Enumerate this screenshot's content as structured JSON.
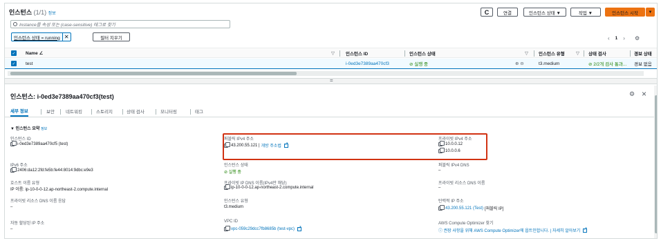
{
  "header": {
    "title": "인스턴스",
    "count": "(1/1)",
    "info": "정보",
    "search_placeholder": "Instance를 속성 또는 (case-sensitive) 태그로 찾기",
    "connect_label": "연결",
    "state_label": "인스턴스 상태 ▼",
    "actions_label": "작업 ▼",
    "launch_label": "인스턴스 시작",
    "refresh_icon": "C",
    "dropdown_icon": "▼"
  },
  "filter": {
    "token": "인스턴스 상태 = running",
    "remove": "✕",
    "clear_label": "필터 지우기"
  },
  "pagination": {
    "prev": "‹",
    "page": "1",
    "next": "›",
    "settings_icon": "⚙"
  },
  "table": {
    "columns": {
      "name": "Name ∠",
      "instance_id": "인스턴스 ID",
      "instance_state": "인스턴스 상태",
      "instance_type": "인스턴스 유형",
      "status_check": "상태 검사",
      "alarm_status": "경보 상태"
    },
    "row": {
      "name": "test",
      "instance_id": "i-0ed3e7389aa470cf3",
      "instance_state": "⊘ 실행 중",
      "zoom_icons": "⊕ ⊖",
      "instance_type": "t3.medium",
      "status_check": "⊘ 2/2개 검사 통과...",
      "alarm_status": "경보 없음"
    },
    "check": "✓"
  },
  "detail": {
    "title": "인스턴스: i-0ed3e7389aa470cf3(test)",
    "settings_icon": "⚙",
    "close_icon": "×",
    "resize_handle": "=",
    "tabs": [
      "세부 정보",
      "보안",
      "네트워킹",
      "스토리지",
      "상태 검사",
      "모니터링",
      "태그"
    ],
    "summary_title": "▼ 인스턴스 요약",
    "summary_info": "정보",
    "fields": {
      "instance_id_label": "인스턴스 ID",
      "instance_id_value": "i-0ed3e7389aa470cf5 (test)",
      "public_ipv4_label": "퍼블릭 IPv4 주소",
      "public_ipv4_value": "43.200.55.121 |",
      "public_ipv4_open": "개방 주소법",
      "private_ipv4_label": "프라이빗 IPv4 주소",
      "private_ipv4_value1": "10.0.0.12",
      "private_ipv4_value2": "10.0.0.6",
      "ipv6_label": "IPv6 주소",
      "ipv6_value": "2406:da12:2fd:fe5b:fe44:8014:9dbc:e9e3",
      "state_label": "인스턴스 상태",
      "state_value": "⊘ 실행 중",
      "public_dns_label": "퍼블릭 IPv4 DNS",
      "public_dns_value": "–",
      "hostname_type_label": "호스트 이름 유형",
      "hostname_type_value": "IP 이름: ip-10-0-0-12.ap-northeast-2.compute.internal",
      "private_dns_ipv4_label": "프라이빗 IP DNS 이름(IPv4만 해당)",
      "private_dns_ipv4_value": "ip-10-0-0-12.ap-northeast-2.compute.internal",
      "private_resource_dns_label": "프라이빗 리소스 DNS 이름",
      "private_resource_dns_value": "–",
      "private_dns_response_label": "프라이빗 리소스 DNS 이름 응답",
      "private_dns_response_value": "–",
      "instance_type_label": "인스턴스 유형",
      "instance_type_value": "t3.medium",
      "elastic_ip_label": "탄력적 IP 주소",
      "elastic_ip_value": "43.200.55.121 (Test)",
      "elastic_ip_suffix": "[퍼블릭 IP]",
      "auto_ip_label": "자동 할당된 IP 주소",
      "auto_ip_value": "–",
      "vpc_label": "VPC ID",
      "vpc_value": "vpc-059c29dcc7fb8685b (test-vpc)",
      "optimizer_label": "AWS Compute Optimizer 찾기",
      "optimizer_value": "ⓘ 권장 사항을 위해 AWS Compute Optimizer에 옵트인합니다. | 자세히 알아보기"
    }
  },
  "colors": {
    "accent": "#0073bb",
    "primary_button": "#ec7211",
    "highlight_box": "#d13212",
    "success": "#1d8102"
  }
}
